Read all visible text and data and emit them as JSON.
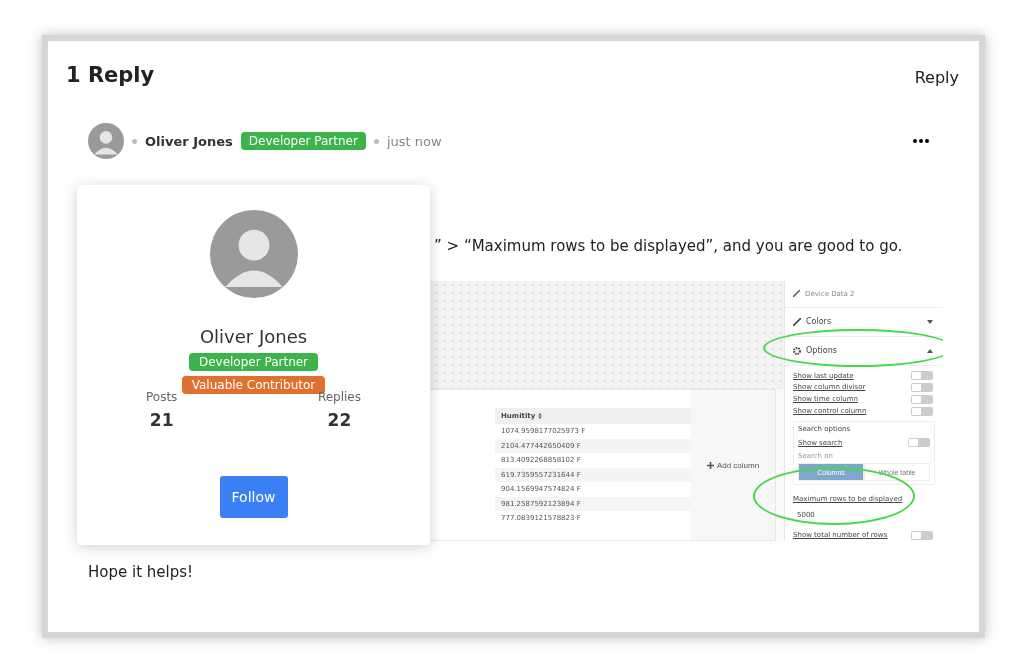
{
  "thread": {
    "title": "1 Reply",
    "reply_link": "Reply"
  },
  "post": {
    "author": "Oliver Jones",
    "badge": "Developer Partner",
    "time": "just now",
    "body_visible": "” > “Maximum rows to be displayed”, and you are good to go.",
    "closing": "Hope it helps!"
  },
  "screenshot": {
    "top_item": "Device Data 2",
    "sections": [
      {
        "label": "Colors",
        "expanded": false
      },
      {
        "label": "Options",
        "expanded": true
      }
    ],
    "toggles": [
      {
        "label": "Show last update",
        "on": false
      },
      {
        "label": "Show column divisor",
        "on": false
      },
      {
        "label": "Show time column",
        "on": false
      },
      {
        "label": "Show control column",
        "on": false
      }
    ],
    "search_group": {
      "title": "Search options",
      "toggle": {
        "label": "Show search",
        "on": false
      },
      "search_on": "Search on",
      "segments": [
        {
          "label": "Columns",
          "selected": true
        },
        {
          "label": "Whole table",
          "selected": false
        }
      ]
    },
    "max_rows": {
      "label": "Maximum rows to be displayed",
      "value": "5000"
    },
    "total_toggle": {
      "label": "Show total number of rows",
      "on": false
    },
    "table": {
      "column": "Humitity",
      "rows": [
        "1074.9598177025973 F",
        "2104.477442650409 F",
        "813.4092268858102 F",
        "619.7359557231644 F",
        "904.1569947574824 F",
        "981.2587592123894 F",
        "777.0839121578823 F"
      ]
    },
    "add_column": "Add column"
  },
  "popover": {
    "name": "Oliver Jones",
    "badges": [
      {
        "label": "Developer Partner",
        "color": "#3cb44b"
      },
      {
        "label": "Valuable Contributor",
        "color": "#e0702e"
      }
    ],
    "stats": [
      {
        "label": "Posts",
        "value": "21"
      },
      {
        "label": "Replies",
        "value": "22"
      }
    ],
    "follow": "Follow"
  }
}
